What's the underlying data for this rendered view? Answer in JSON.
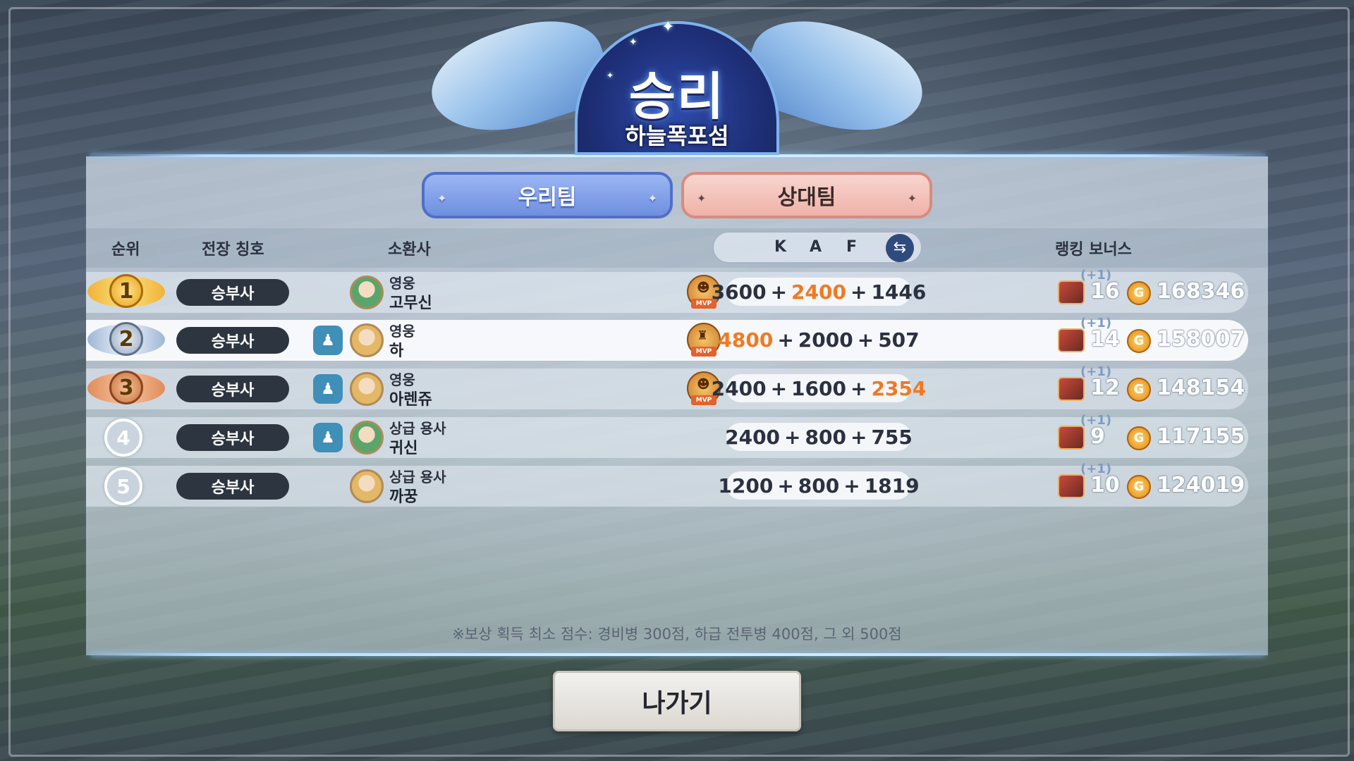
{
  "result": {
    "title": "승리",
    "map": "하늘폭포섬"
  },
  "tabs": {
    "ours": "우리팀",
    "opponent": "상대팀"
  },
  "headers": {
    "rank": "순위",
    "battle_title": "전장 칭호",
    "summoner": "소환사",
    "k": "K",
    "a": "A",
    "f": "F",
    "ranking_bonus": "랭킹 보너스"
  },
  "players": [
    {
      "rank": "1",
      "title": "승부사",
      "grade": "영웅",
      "name": "고무신",
      "party": false,
      "mvp": true,
      "k": "3600",
      "a": "2400",
      "f": "1446",
      "highlight": "a",
      "bonus_plus": "(+1)",
      "bonus": "16",
      "gold": "168346"
    },
    {
      "rank": "2",
      "title": "승부사",
      "grade": "영웅",
      "name": "하",
      "party": true,
      "mvp": true,
      "k": "4800",
      "a": "2000",
      "f": "507",
      "highlight": "k",
      "bonus_plus": "(+1)",
      "bonus": "14",
      "gold": "158007"
    },
    {
      "rank": "3",
      "title": "승부사",
      "grade": "영웅",
      "name": "아렌쥬",
      "party": true,
      "mvp": true,
      "k": "2400",
      "a": "1600",
      "f": "2354",
      "highlight": "f",
      "bonus_plus": "(+1)",
      "bonus": "12",
      "gold": "148154"
    },
    {
      "rank": "4",
      "title": "승부사",
      "grade": "상급 용사",
      "name": "귀신",
      "party": true,
      "mvp": false,
      "k": "2400",
      "a": "800",
      "f": "755",
      "highlight": "",
      "bonus_plus": "(+1)",
      "bonus": "9",
      "gold": "117155"
    },
    {
      "rank": "5",
      "title": "승부사",
      "grade": "상급 용사",
      "name": "까꿍",
      "party": false,
      "mvp": false,
      "k": "1200",
      "a": "800",
      "f": "1819",
      "highlight": "",
      "bonus_plus": "(+1)",
      "bonus": "10",
      "gold": "124019"
    }
  ],
  "plus_sign": "+",
  "mvp_label": "MVP",
  "note": "※보상 획득 최소 점수: 경비병 300점, 하급 전투병 400점, 그 외 500점",
  "exit_label": "나가기",
  "colors": {
    "highlight": "#f07a22",
    "tab_ours": "#7b98e6",
    "tab_opp": "#f1bcb3",
    "pill": "#2c3540"
  }
}
